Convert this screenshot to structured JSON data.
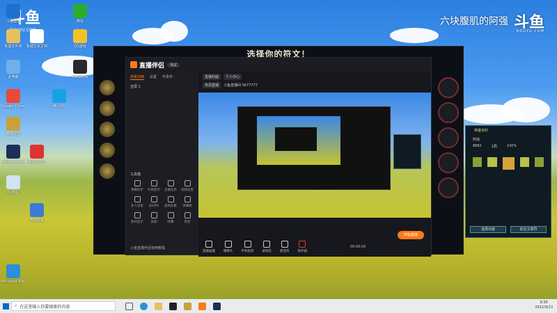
{
  "watermark": {
    "title": "六块腹肌的阿强",
    "brand": "斗鱼",
    "sub": "DOUYU.COM"
  },
  "logo_tl": {
    "brand": "斗鱼",
    "sub": "DOUYU.COM"
  },
  "desktop": {
    "icons": [
      {
        "label": "斗鱼直播",
        "color": "#1e6fd1"
      },
      {
        "label": "微信",
        "color": "#2aae2a"
      },
      {
        "label": "新建文件夹",
        "color": "#e7c15d"
      },
      {
        "label": "新建文本文档",
        "color": "#ffffff"
      },
      {
        "label": "QQ游戏",
        "color": "#f5c02a"
      },
      {
        "label": "此电脑",
        "color": "#6fb0e8"
      },
      {
        "label": "WeGame",
        "color": "#2a2a2a"
      },
      {
        "label": "Google Chrome",
        "color": "#e94a3a"
      },
      {
        "label": "腾讯QQ",
        "color": "#1aa0e8"
      },
      {
        "label": "英雄联盟",
        "color": "#c8a13a"
      },
      {
        "label": "Adobe Photoshop",
        "color": "#1b2f5a"
      },
      {
        "label": "网易云音乐",
        "color": "#d33"
      },
      {
        "label": "回收站",
        "color": "#cfe3f7"
      },
      {
        "label": "控制面板",
        "color": "#3a7bd5"
      },
      {
        "label": "Microsoft Edge",
        "color": "#2d8fd8"
      }
    ]
  },
  "game": {
    "title": "选择你的符文！"
  },
  "app": {
    "name": "直播伴侣",
    "version_badge": "测试",
    "tabs": [
      "场景切换",
      "设置",
      "可发布"
    ],
    "scene": "全屏 1",
    "tools_header": "工具箱",
    "tools": [
      "弹幕助手",
      "礼物提示",
      "主播任务",
      "视频连麦",
      "多人连麦",
      "房间PK",
      "虚拟形象",
      "弹幕姬",
      "歌词显示",
      "美颜",
      "绿幕",
      "其他"
    ],
    "sidebar_footer": "斗鱼直播伴侣使用教程",
    "head_line1": [
      "直播封面",
      "个人中心"
    ],
    "head_line2": [
      "高清直播",
      "斗鱼直播间 5677777"
    ],
    "bottom_buttons": [
      "直播画面",
      "摄像头",
      "手机投屏",
      "录屏区",
      "麦克风",
      "扬声器"
    ],
    "start_button": "开始直播",
    "timer": "00:00:00"
  },
  "panel": {
    "header": "英雄资料",
    "player": "阿强",
    "stats": [
      "8882",
      "1局",
      "100%"
    ],
    "buttons": [
      "选择出装",
      "前往文章符"
    ]
  },
  "taskbar": {
    "search_placeholder": "在这里输入你要搜索的内容",
    "time": "8:36",
    "date": "2021/9/13"
  }
}
